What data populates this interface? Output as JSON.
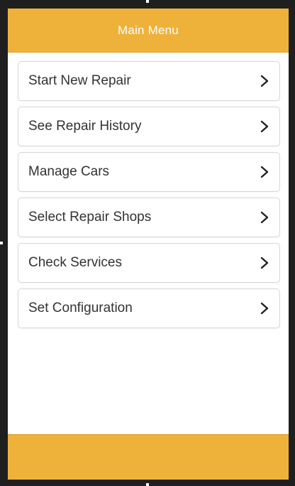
{
  "header": {
    "title": "Main Menu"
  },
  "menu": {
    "items": [
      {
        "label": "Start New Repair",
        "icon": "chevron-right-icon"
      },
      {
        "label": "See Repair History",
        "icon": "chevron-right-icon"
      },
      {
        "label": "Manage Cars",
        "icon": "chevron-right-icon"
      },
      {
        "label": "Select Repair Shops",
        "icon": "chevron-right-icon"
      },
      {
        "label": "Check Services",
        "icon": "chevron-right-icon"
      },
      {
        "label": "Set Configuration",
        "icon": "chevron-right-icon"
      }
    ]
  },
  "colors": {
    "bar": "#eeb23b",
    "frame": "#1f1f1f",
    "text": "#333333"
  }
}
